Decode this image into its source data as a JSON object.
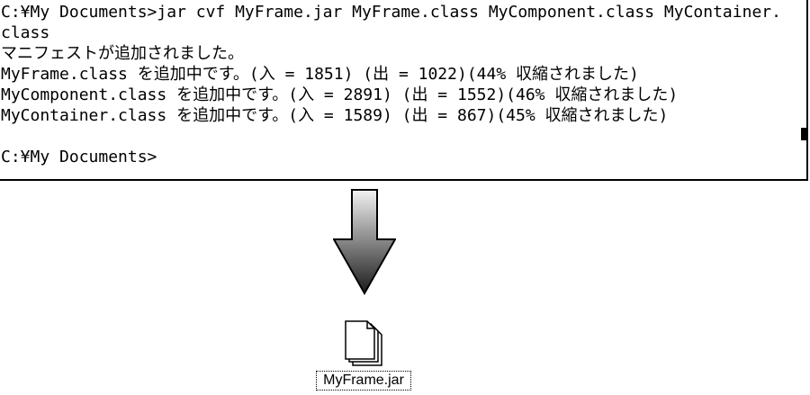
{
  "console": {
    "lines": [
      "C:¥My Documents>jar cvf MyFrame.jar MyFrame.class MyComponent.class MyContainer.",
      "class",
      "マニフェストが追加されました。",
      "MyFrame.class を追加中です。(入 = 1851) (出 = 1022)(44% 収縮されました)",
      "MyComponent.class を追加中です。(入 = 2891) (出 = 1552)(46% 収縮されました)",
      "MyContainer.class を追加中です。(入 = 1589) (出 = 867)(45% 収縮されました)",
      "",
      "C:¥My Documents>"
    ]
  },
  "arrow": {
    "icon": "down-arrow-icon",
    "color_top": "#f2f2f2",
    "color_bottom": "#1a1a1a"
  },
  "file": {
    "icon": "document-stack-icon",
    "label": "MyFrame.jar"
  }
}
